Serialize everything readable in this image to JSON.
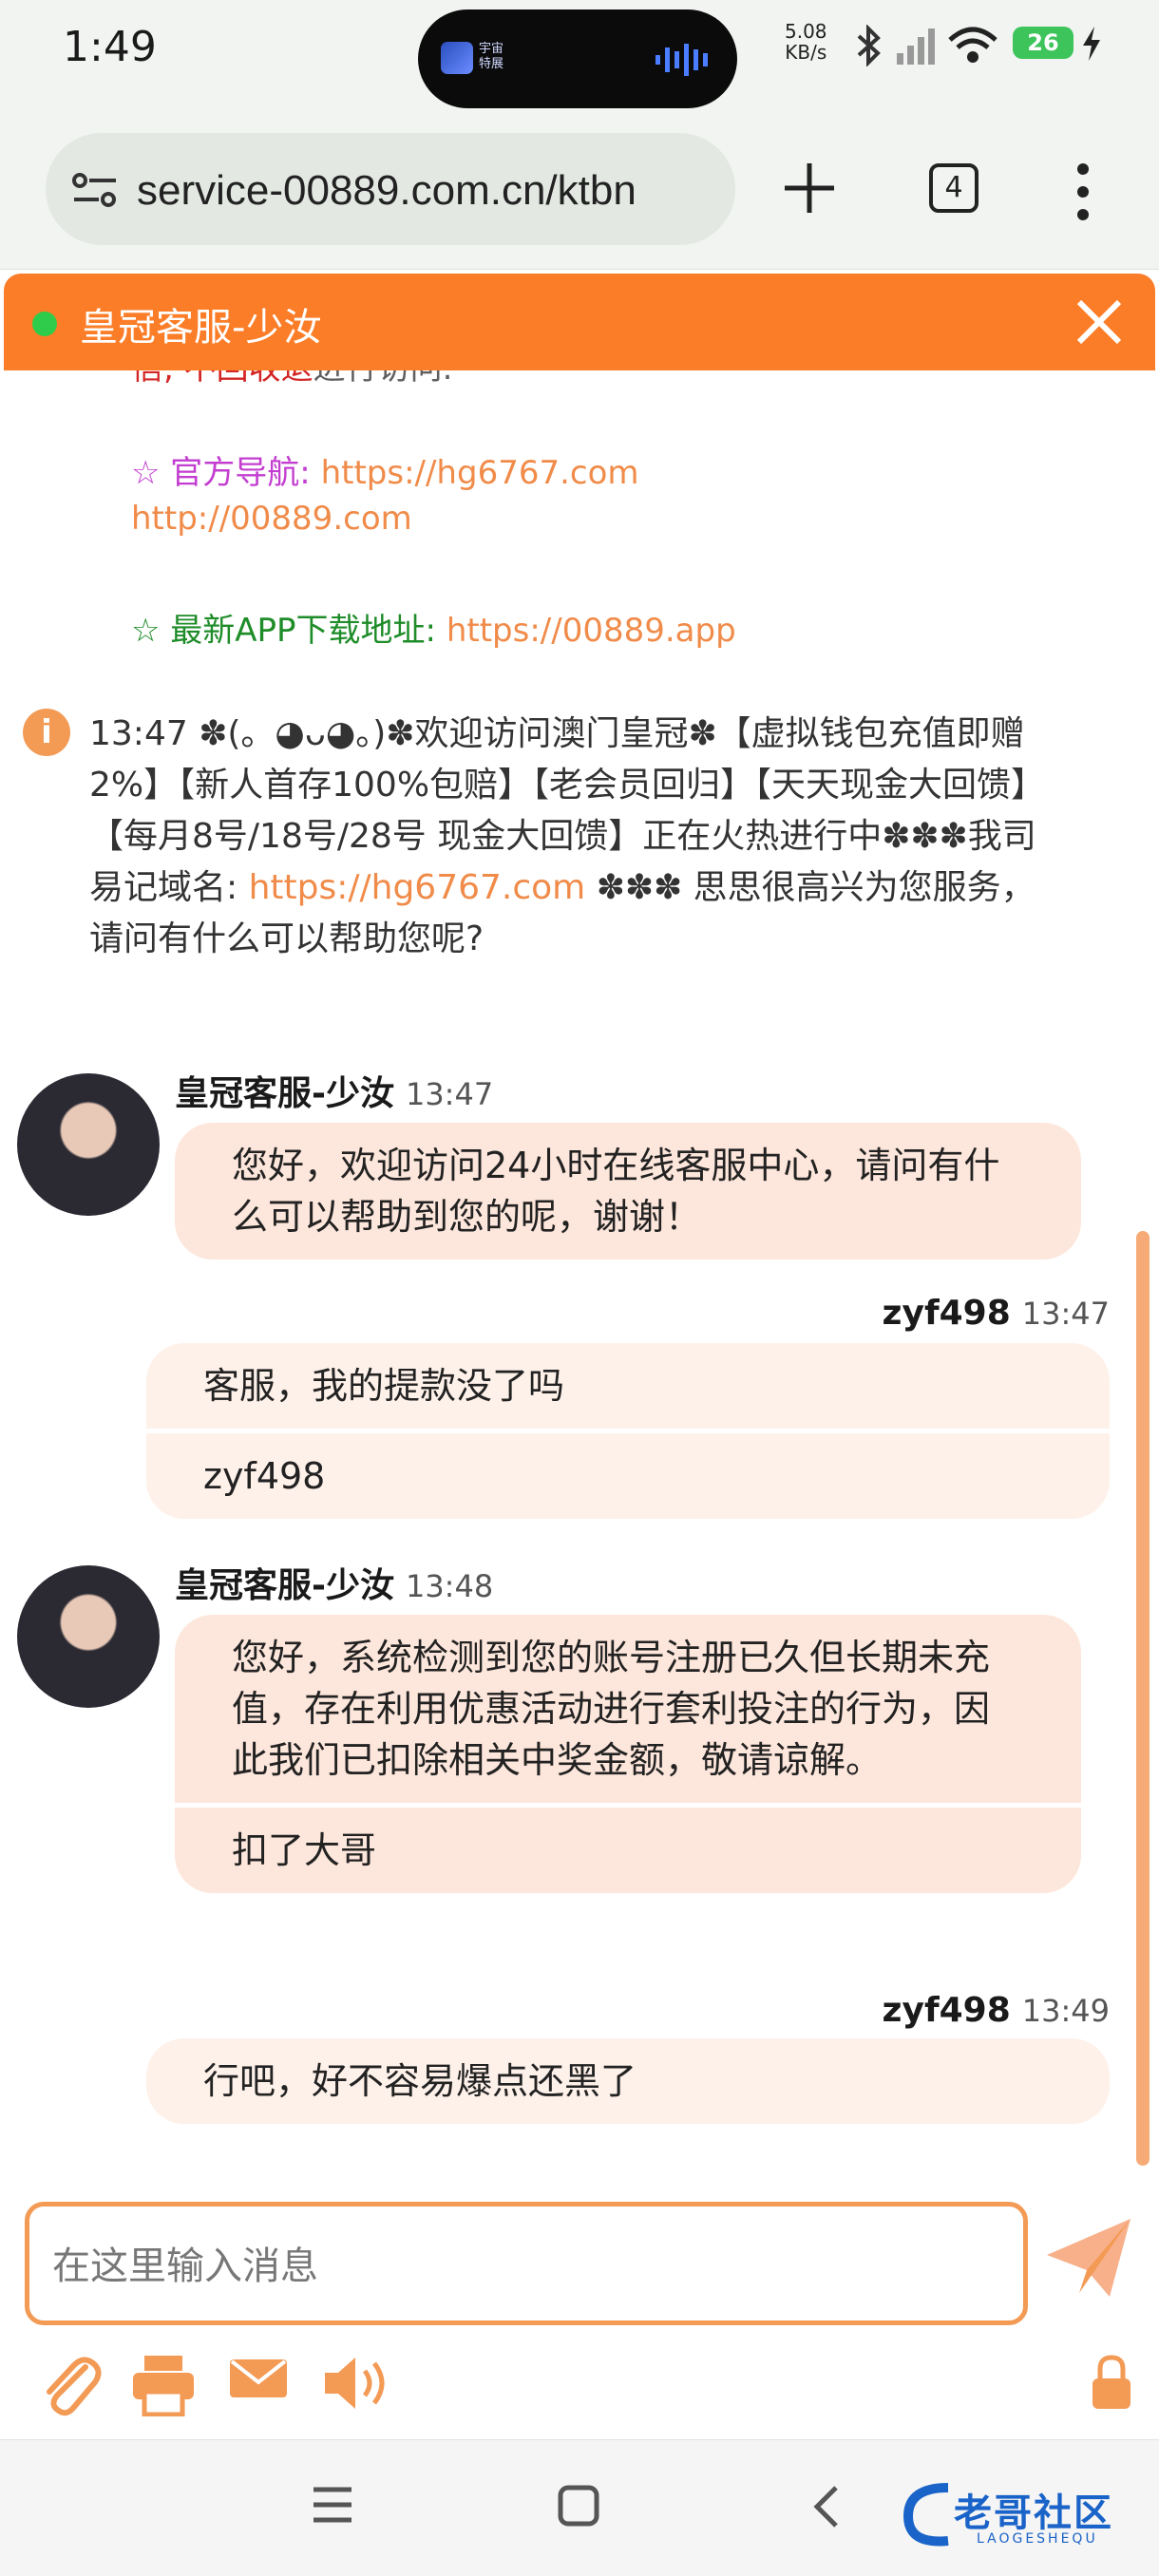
{
  "status_bar": {
    "time": "1:49",
    "island_app_label": "宇宙\n特展",
    "net_speed": "5.08\nKB/s",
    "battery": "26"
  },
  "browser": {
    "url": "service-00889.com.cn/ktbn",
    "tab_count": "4"
  },
  "chat_header": {
    "title": "皇冠客服-少汝"
  },
  "notices": {
    "cutoff_red": "信, 不回收退",
    "cutoff_rest": "进行访问.",
    "nav_label": "☆ 官方导航:",
    "nav_url": "https://hg6767.com",
    "nav_url2": "http://00889.com",
    "app_label": "☆ 最新APP下载地址:",
    "app_url": "https://00889.app"
  },
  "system_message": {
    "time": "13:47",
    "text_before": "✽(。◕ᴗ◕。)✽欢迎访问澳门皇冠✽【虚拟钱包充值即赠2%】【新人首存100%包赔】【老会员回归】【天天现金大回馈】【每月8号/18号/28号 现金大回馈】正在火热进行中✽✽✽我司易记域名:",
    "link": "https://hg6767.com",
    "text_after": " ✽✽✽ 思思很高兴为您服务，请问有什么可以帮助您呢?"
  },
  "messages": [
    {
      "sender": "皇冠客服-少汝",
      "time": "13:47",
      "parts": [
        "您好，欢迎访问24小时在线客服中心，请问有什么可以帮助到您的呢，谢谢！"
      ]
    },
    {
      "sender": "zyf498",
      "time": "13:47",
      "parts": [
        "客服，我的提款没了吗",
        "zyf498"
      ]
    },
    {
      "sender": "皇冠客服-少汝",
      "time": "13:48",
      "parts": [
        "您好，系统检测到您的账号注册已久但长期未充值，存在利用优惠活动进行套利投注的行为，因此我们已扣除相关中奖金额，敬请谅解。",
        "扣了大哥"
      ]
    },
    {
      "sender": "zyf498",
      "time": "13:49",
      "parts": [
        "行吧，好不容易爆点还黑了"
      ]
    }
  ],
  "composer": {
    "placeholder": "在这里输入消息"
  },
  "watermark": {
    "text": "老哥社区",
    "sub": "LAOGESHEQU"
  },
  "colors": {
    "accent": "#fb7d27",
    "agent_bubble": "#fde6db",
    "user_bubble": "#fef1ea",
    "link": "#f08b49"
  }
}
